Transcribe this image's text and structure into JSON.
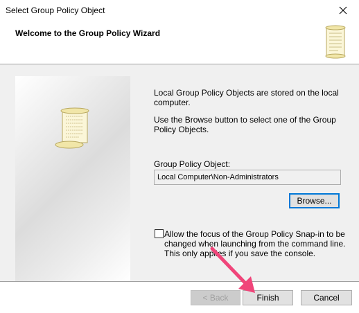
{
  "window": {
    "title": "Select Group Policy Object"
  },
  "header": {
    "title": "Welcome to the Group Policy Wizard",
    "icon": "scroll-icon"
  },
  "info": {
    "stored": "Local Group Policy Objects are stored on the local computer.",
    "browse_hint": "Use the Browse button to select one of the Group Policy Objects."
  },
  "gpo": {
    "label": "Group Policy Object:",
    "value": "Local Computer\\Non-Administrators",
    "browse_label": "Browse..."
  },
  "focus_option": {
    "checked": false,
    "label": "Allow the focus of the Group Policy Snap-in to be changed when launching from the command line. This only applies if you save the console."
  },
  "footer": {
    "back_label": "< Back",
    "finish_label": "Finish",
    "cancel_label": "Cancel"
  },
  "colors": {
    "accent": "#0078d7",
    "annotation_arrow": "#f0457a"
  }
}
